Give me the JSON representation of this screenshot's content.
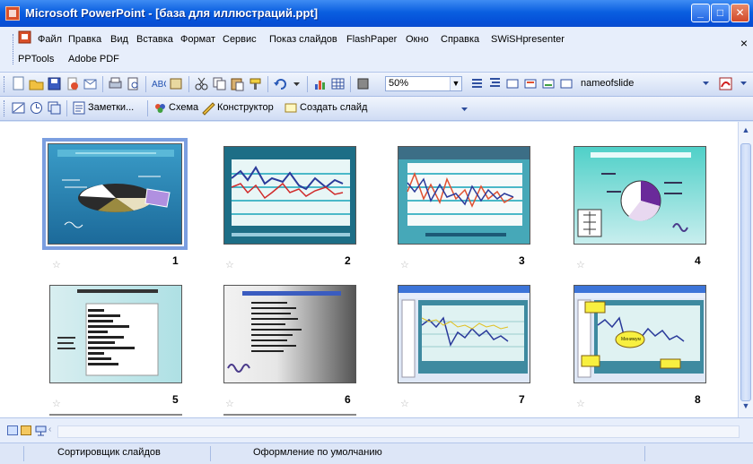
{
  "window": {
    "title": "Microsoft PowerPoint - [база для иллюстраций.ppt]"
  },
  "menu": {
    "items": [
      "Файл",
      "Правка",
      "Вид",
      "Вставка",
      "Формат",
      "Сервис",
      "Показ слайдов",
      "FlashPaper",
      "Окно",
      "Справка",
      "SWiSHpresenter",
      "PPTools",
      "Adobe PDF"
    ],
    "close_label": "×"
  },
  "toolbar": {
    "zoom_value": "50%",
    "name_field_label": "nameofslide"
  },
  "slide_sorter_toolbar": {
    "notes_label": "Заметки...",
    "scheme_label": "Схема",
    "designer_label": "Конструктор",
    "new_slide_label": "Создать слайд"
  },
  "slides": [
    {
      "number": "1",
      "selected": true
    },
    {
      "number": "2",
      "selected": false
    },
    {
      "number": "3",
      "selected": false
    },
    {
      "number": "4",
      "selected": false
    },
    {
      "number": "5",
      "selected": false
    },
    {
      "number": "6",
      "selected": false
    },
    {
      "number": "7",
      "selected": false
    },
    {
      "number": "8",
      "selected": false
    }
  ],
  "slide8_callouts": {
    "c1": "Минимум"
  },
  "status": {
    "view": "Сортировщик слайдов",
    "design": "Оформление по умолчанию"
  },
  "colors": {
    "title_bar": "#0a5fe0",
    "selection": "#7b9ee0",
    "chart_teal": "#4ab8c8"
  }
}
